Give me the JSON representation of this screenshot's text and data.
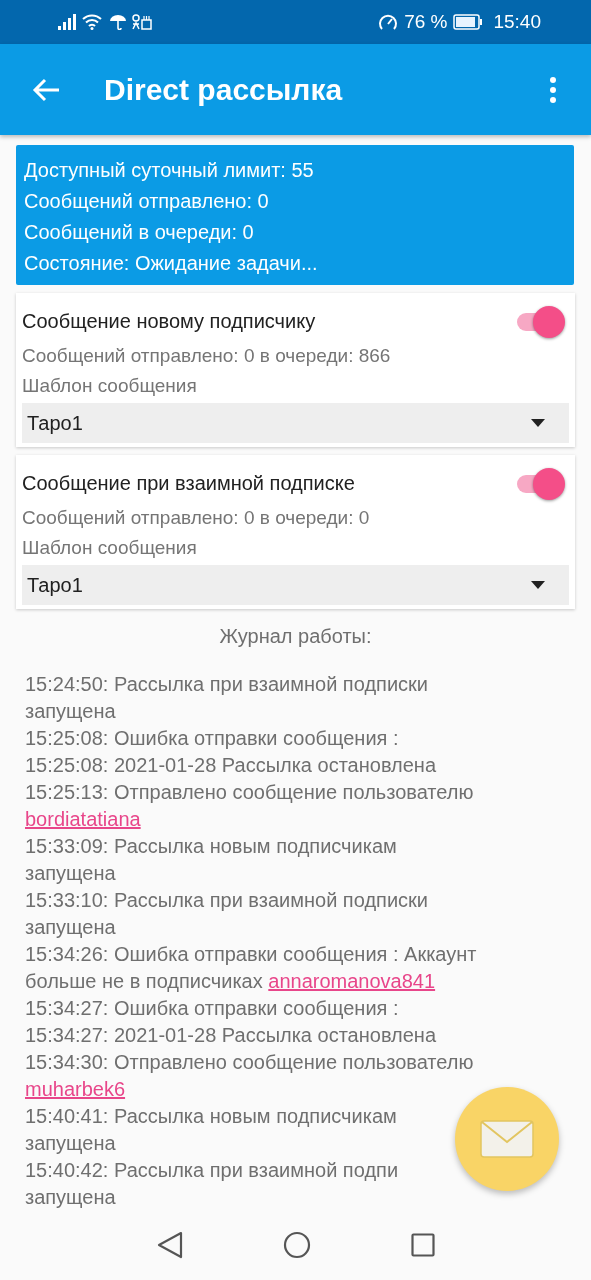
{
  "status_bar": {
    "battery_percent": "76 %",
    "time": "15:40"
  },
  "toolbar": {
    "title": "Direct рассылка"
  },
  "info": [
    "Доступный суточный лимит: 55",
    "Сообщений отправлено: 0",
    "Сообщений в очереди: 0",
    "Состояние: Ожидание задачи..."
  ],
  "cards": [
    {
      "title": "Сообщение новому подписчику",
      "on": true,
      "stats": "Сообщений отправлено: 0 в очереди: 866",
      "template_label": "Шаблон сообщения",
      "template": "Таро1"
    },
    {
      "title": "Сообщение при взаимной подписке",
      "on": true,
      "stats": "Сообщений отправлено: 0 в очереди: 0",
      "template_label": "Шаблон сообщения",
      "template": "Таро1"
    }
  ],
  "log": {
    "title": "Журнал работы:",
    "lines": [
      {
        "text": "15:24:50: Рассылка при взаимной подписки"
      },
      {
        "text": "запущена"
      },
      {
        "text": "15:25:08: Ошибка отправки сообщения :"
      },
      {
        "text": "15:25:08: 2021-01-28 Рассылка остановлена"
      },
      {
        "text": "15:25:13: Отправлено сообщение пользователю"
      },
      {
        "link": "bordiatatiana"
      },
      {
        "text": "15:33:09: Рассылка новым подписчикам"
      },
      {
        "text": "запущена"
      },
      {
        "text": "15:33:10: Рассылка при взаимной подписки"
      },
      {
        "text": "запущена"
      },
      {
        "text": "15:34:26: Ошибка отправки сообщения : Аккаунт"
      },
      {
        "text": "больше не в подписчиках",
        "link": "annaromanova841"
      },
      {
        "text": "15:34:27: Ошибка отправки сообщения :"
      },
      {
        "text": "15:34:27: 2021-01-28 Рассылка остановлена"
      },
      {
        "text": "15:34:30: Отправлено сообщение пользователю"
      },
      {
        "link": "muharbek6"
      },
      {
        "text": "15:40:41: Рассылка новым подписчикам"
      },
      {
        "text": "запущена"
      },
      {
        "text": "15:40:42: Рассылка при взаимной подпи"
      },
      {
        "text": "запущена"
      }
    ]
  }
}
